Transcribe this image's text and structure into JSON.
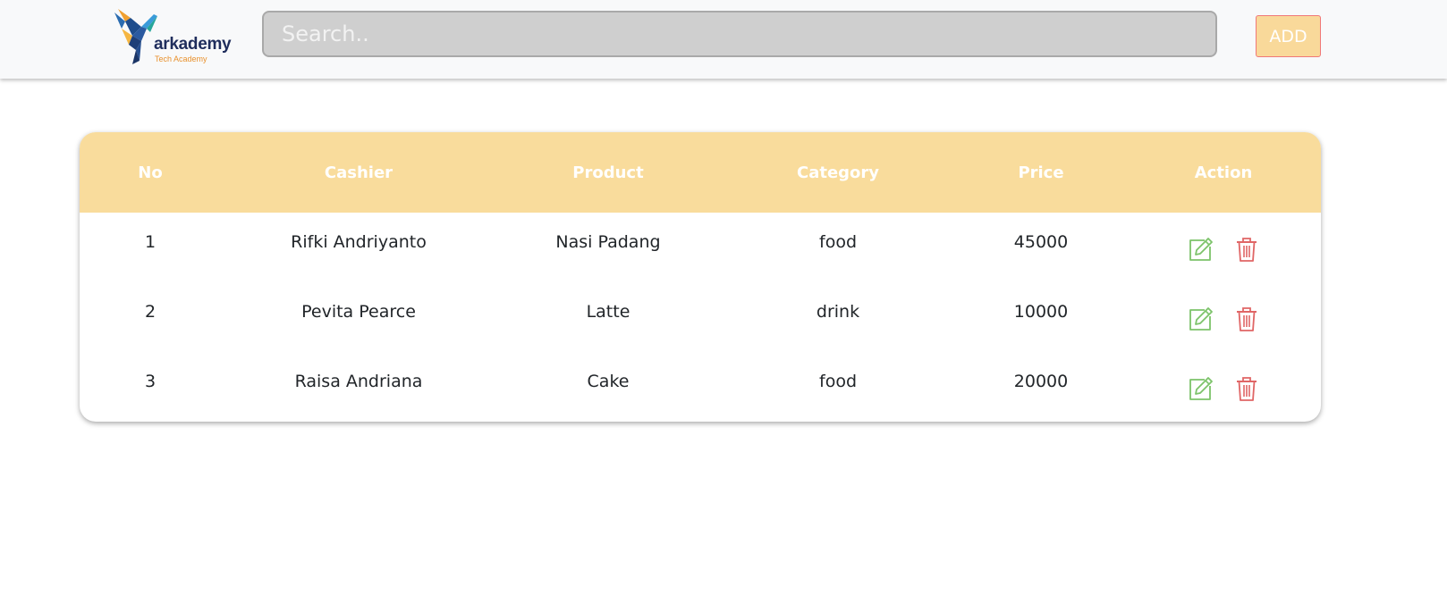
{
  "brand": {
    "name": "arkademy",
    "tagline": "Tech Academy",
    "logo_icon": "hummingbird-logo-icon"
  },
  "search": {
    "placeholder": "Search..",
    "value": ""
  },
  "toolbar": {
    "add_label": "ADD"
  },
  "table": {
    "columns": [
      "No",
      "Cashier",
      "Product",
      "Category",
      "Price",
      "Action"
    ],
    "rows": [
      {
        "no": "1",
        "cashier": "Rifki Andriyanto",
        "product": "Nasi Padang",
        "category": "food",
        "price": "45000"
      },
      {
        "no": "2",
        "cashier": "Pevita Pearce",
        "product": "Latte",
        "category": "drink",
        "price": "10000"
      },
      {
        "no": "3",
        "cashier": "Raisa Andriana",
        "product": "Cake",
        "category": "food",
        "price": "20000"
      }
    ],
    "row_actions": [
      "edit-icon",
      "trash-icon"
    ]
  },
  "colors": {
    "header_bg": "#f9dc9c",
    "add_button_bg": "#f9d99a",
    "add_button_border": "#f07878",
    "edit_icon": "#7cc36a",
    "delete_icon": "#e06666",
    "brand_text": "#1f2d5c",
    "brand_tagline": "#e8912d"
  }
}
